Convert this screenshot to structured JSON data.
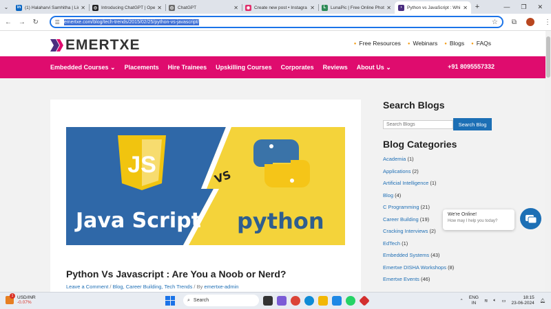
{
  "browser": {
    "tabs": [
      {
        "title": "(1) Halaharvi Samhitha | Lin",
        "favicon": "linkedin-icon",
        "color": "#0a66c2",
        "active": false
      },
      {
        "title": "Introducing ChatGPT | Ope",
        "favicon": "openai-icon",
        "color": "#202123",
        "active": false
      },
      {
        "title": "ChatGPT",
        "favicon": "chatgpt-icon",
        "color": "#6b6b6b",
        "active": false
      },
      {
        "title": "Create new post • Instagra",
        "favicon": "instagram-icon",
        "color": "#e1306c",
        "active": false
      },
      {
        "title": "LunaPic | Free Online Photo",
        "favicon": "lunapic-icon",
        "color": "#2e8b57",
        "active": false
      },
      {
        "title": "Python vs JavaScript : Whi",
        "favicon": "emertxe-icon",
        "color": "#4b2d7f",
        "active": true
      }
    ],
    "url": "emertxe.com/blog/tech-trends/2015/02/25/python-vs-javascript/"
  },
  "site": {
    "logo_text": "EMERTXE",
    "top_links": [
      "Free Resources",
      "Webinars",
      "Blogs",
      "FAQs"
    ],
    "nav": [
      "Embedded Courses ⌄",
      "Placements",
      "Hire Trainees",
      "Upskilling Courses",
      "Corporates",
      "Reviews",
      "About Us ⌄"
    ],
    "phone": "+91 8095557332"
  },
  "post": {
    "hero_left": "Java Script",
    "hero_right": "python",
    "hero_js_badge": "JS",
    "hero_vs": "VS",
    "title": "Python Vs Javascript : Are You a Noob or Nerd?",
    "meta": {
      "comment": "Leave a Comment",
      "sep1": " / ",
      "cats": "Blog, Career Building, Tech Trends",
      "by": " / By ",
      "author": "emertxe-admin"
    }
  },
  "sidebar": {
    "search_heading": "Search Blogs",
    "search_placeholder": "Search Blogs",
    "search_button": "Search Blog",
    "categories_heading": "Blog Categories",
    "categories": [
      {
        "name": "Academia",
        "count": "(1)"
      },
      {
        "name": "Applications",
        "count": "(2)"
      },
      {
        "name": "Artificial Intelligence",
        "count": "(1)"
      },
      {
        "name": "Blog",
        "count": "(4)"
      },
      {
        "name": "C Programming",
        "count": "(21)"
      },
      {
        "name": "Career Building",
        "count": "(19)"
      },
      {
        "name": "Cracking Interviews",
        "count": "(2)"
      },
      {
        "name": "EdTech",
        "count": "(1)"
      },
      {
        "name": "Embedded Systems",
        "count": "(43)"
      },
      {
        "name": "Emertxe DISHA Workshops",
        "count": "(8)"
      },
      {
        "name": "Emertxe Events",
        "count": "(46)"
      }
    ]
  },
  "chat": {
    "line1": "We're Online!",
    "line2": "How may I help you today?"
  },
  "taskbar": {
    "weather_title": "USD/INR",
    "weather_value": "-0.07%",
    "badge": "1",
    "search": "Search",
    "lang1": "ENG",
    "lang2": "IN",
    "time": "18:15",
    "date": "23-06-2024"
  }
}
